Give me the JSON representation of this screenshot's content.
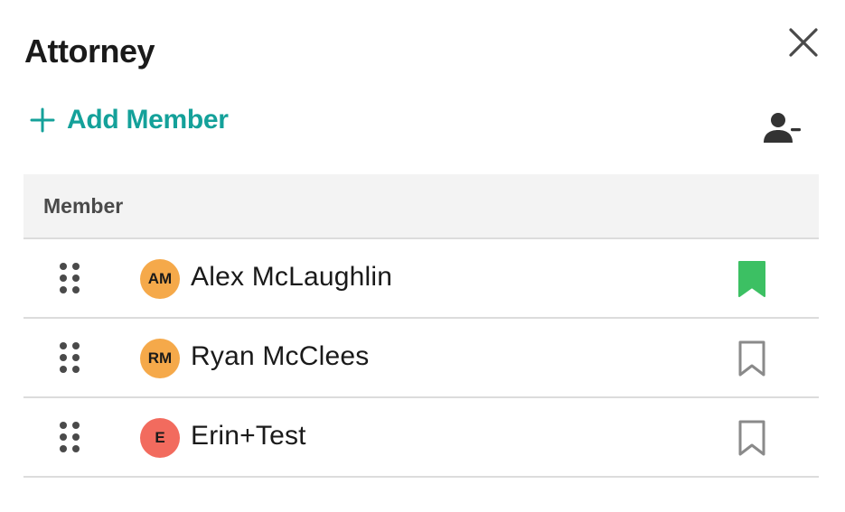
{
  "panel": {
    "title": "Attorney",
    "close_icon": "close-icon"
  },
  "toolbar": {
    "add_member_label": "Add Member",
    "add_icon": "plus-icon",
    "remove_member_icon": "person-remove-icon",
    "accent_color": "#14a19a"
  },
  "table": {
    "column_header": "Member",
    "rows": [
      {
        "initials": "AM",
        "name": "Alex McLaughlin",
        "avatar_color": "#f5a94a",
        "bookmarked": true
      },
      {
        "initials": "RM",
        "name": "Ryan McClees",
        "avatar_color": "#f5a94a",
        "bookmarked": false
      },
      {
        "initials": "E",
        "name": "Erin+Test",
        "avatar_color": "#f26b5e",
        "bookmarked": false
      }
    ],
    "bookmark_active_color": "#3cc063",
    "bookmark_inactive_color": "#8a8a8a"
  }
}
